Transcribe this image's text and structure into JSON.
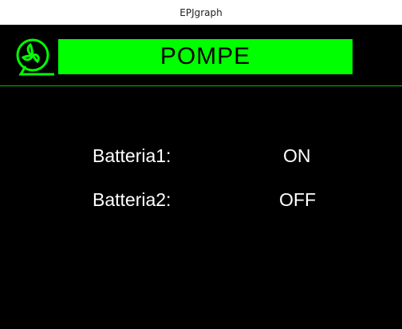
{
  "window": {
    "title": "EPJgraph"
  },
  "screen": {
    "title": "POMPE",
    "icon": "pump-icon",
    "accent_color": "#00ff00",
    "rows": [
      {
        "label": "Batteria1:",
        "value": "ON"
      },
      {
        "label": "Batteria2:",
        "value": "OFF"
      }
    ]
  }
}
